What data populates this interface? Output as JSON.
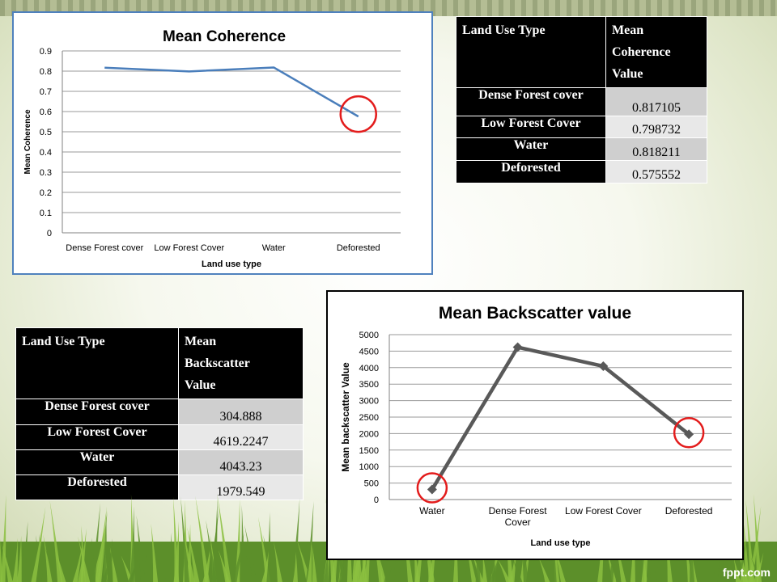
{
  "chart_data": [
    {
      "type": "line",
      "title": "Mean Coherence",
      "xlabel": "Land use type",
      "ylabel": "Mean Coherence",
      "categories": [
        "Dense Forest cover",
        "Low Forest Cover",
        "Water",
        "Deforested"
      ],
      "series": [
        {
          "values": [
            0.817105,
            0.798732,
            0.818211,
            0.575552
          ]
        }
      ],
      "ylim": [
        0,
        0.9
      ],
      "yticks": [
        "0",
        "0.1",
        "0.2",
        "0.3",
        "0.4",
        "0.5",
        "0.6",
        "0.7",
        "0.8",
        "0.9"
      ],
      "grid": true,
      "line_color": "#4a7ebb",
      "highlight_color": "#e31c1c",
      "highlight_index": [
        3
      ]
    },
    {
      "type": "line",
      "title": "Mean Backscatter  value",
      "xlabel": "Land use type",
      "ylabel": "Mean backscatter Value",
      "categories": [
        [
          "Water"
        ],
        [
          "Dense Forest",
          "Cover"
        ],
        [
          "Low Forest Cover"
        ],
        [
          "Deforested"
        ]
      ],
      "series": [
        {
          "values": [
            304.888,
            4619.2247,
            4043.23,
            1979.549
          ]
        }
      ],
      "ylim": [
        0,
        5000
      ],
      "yticks": [
        "0",
        "500",
        "1000",
        "1500",
        "2000",
        "2500",
        "3000",
        "3500",
        "4000",
        "4500",
        "5000"
      ],
      "grid": true,
      "line_color": "#595959",
      "highlight_color": "#e31c1c",
      "highlight_index": [
        0,
        3
      ]
    }
  ],
  "table1": {
    "header_col1": "Land Use Type",
    "header_col2_lines": [
      "Mean",
      "Coherence",
      "Value"
    ],
    "rows": [
      {
        "label": "Dense Forest cover",
        "value": "0.817105"
      },
      {
        "label": "Low Forest Cover",
        "value": "0.798732"
      },
      {
        "label": "Water",
        "value": "0.818211"
      },
      {
        "label": "Deforested",
        "value": "0.575552"
      }
    ]
  },
  "table2": {
    "header_col1": "Land Use Type",
    "header_col2_lines": [
      "Mean",
      "Backscatter",
      "Value"
    ],
    "rows": [
      {
        "label": "Dense Forest cover",
        "value": "304.888"
      },
      {
        "label": "Low Forest Cover",
        "value": "4619.2247"
      },
      {
        "label": "Water",
        "value": "4043.23"
      },
      {
        "label": "Deforested",
        "value": "1979.549"
      }
    ]
  },
  "watermark": "fppt.com",
  "colors": {
    "grass": "#5c8f2a",
    "grass_light": "#8bbf3f",
    "table_header": "#000000"
  }
}
